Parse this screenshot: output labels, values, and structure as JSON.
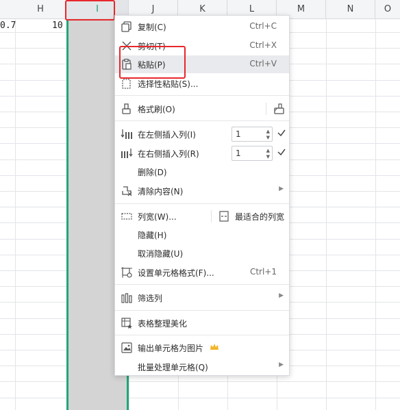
{
  "sheet": {
    "columns": [
      {
        "label": "H"
      },
      {
        "label": "I"
      },
      {
        "label": "J"
      },
      {
        "label": "K"
      },
      {
        "label": "L"
      },
      {
        "label": "M"
      },
      {
        "label": "N"
      },
      {
        "label": "O"
      }
    ],
    "cells": {
      "g1": "0.7",
      "h1": "10"
    },
    "selected_column": "I",
    "selection_color": "#21a67a",
    "highlight_color": "#e8262b"
  },
  "menu": {
    "copy": {
      "label": "复制(C)",
      "shortcut": "Ctrl+C"
    },
    "cut": {
      "label": "剪切(T)",
      "shortcut": "Ctrl+X"
    },
    "paste": {
      "label": "粘贴(P)",
      "shortcut": "Ctrl+V"
    },
    "paste_special": {
      "label": "选择性粘贴(S)..."
    },
    "format_painter": {
      "label": "格式刷(O)"
    },
    "insert_left": {
      "label": "在左侧插入列(I)",
      "count": "1"
    },
    "insert_right": {
      "label": "在右侧插入列(R)",
      "count": "1"
    },
    "delete": {
      "label": "删除(D)"
    },
    "clear": {
      "label": "清除内容(N)"
    },
    "col_width": {
      "label": "列宽(W)...",
      "autofit_label": "最适合的列宽"
    },
    "hide": {
      "label": "隐藏(H)"
    },
    "unhide": {
      "label": "取消隐藏(U)"
    },
    "format_cells": {
      "label": "设置单元格格式(F)...",
      "shortcut": "Ctrl+1"
    },
    "filter": {
      "label": "筛选列"
    },
    "beautify": {
      "label": "表格整理美化"
    },
    "export_image": {
      "label": "输出单元格为图片"
    },
    "batch": {
      "label": "批量处理单元格(Q)"
    }
  }
}
